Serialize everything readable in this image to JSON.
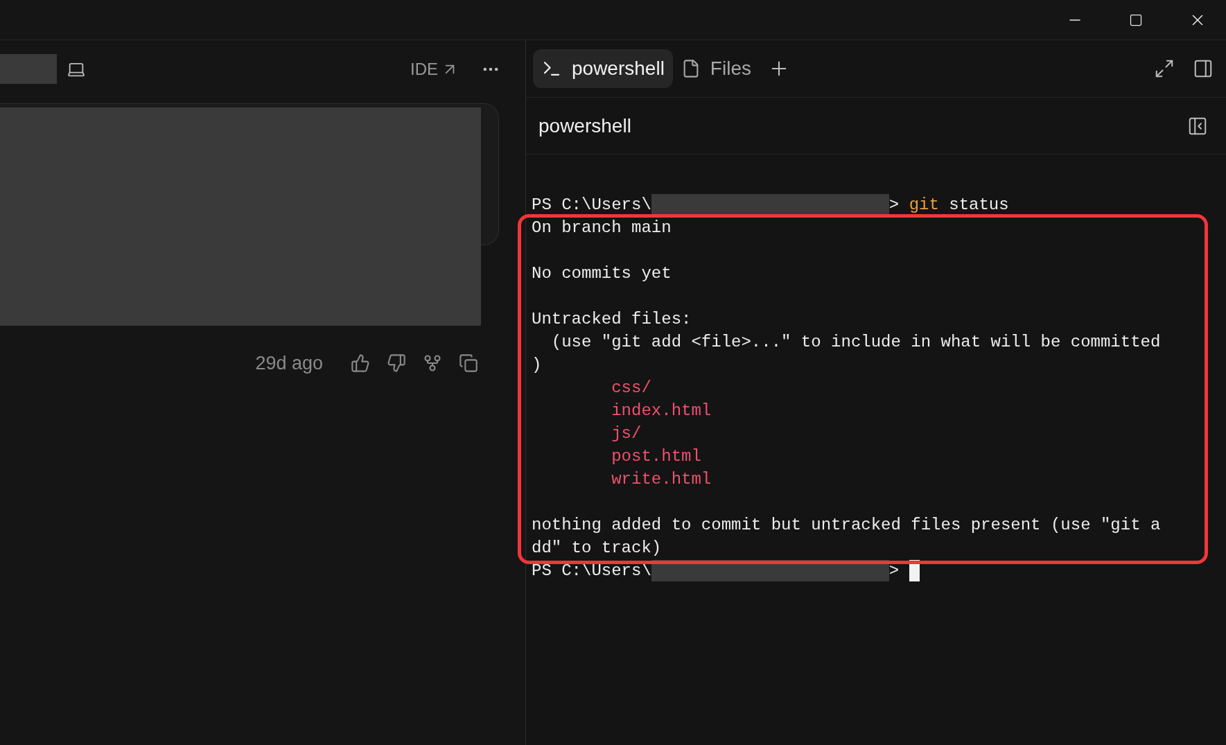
{
  "left_panel": {
    "toolbar": {
      "ide_link": "IDE"
    },
    "message": {
      "timestamp": "29d ago"
    }
  },
  "terminal": {
    "tabs": [
      {
        "label": "powershell",
        "kind": "terminal",
        "selected": true
      },
      {
        "label": "Files",
        "kind": "files",
        "selected": false
      }
    ],
    "title": "powershell",
    "lines": [
      {
        "segments": [
          {
            "kind": "text",
            "text": "PS C:\\Users\\"
          },
          {
            "kind": "redacted"
          },
          {
            "kind": "text",
            "text": "> "
          },
          {
            "kind": "command",
            "text": "git"
          },
          {
            "kind": "text",
            "text": " status"
          }
        ]
      },
      {
        "segments": [
          {
            "kind": "text",
            "text": "On branch main"
          }
        ]
      },
      {
        "kind": "blank"
      },
      {
        "segments": [
          {
            "kind": "text",
            "text": "No commits yet"
          }
        ]
      },
      {
        "kind": "blank"
      },
      {
        "segments": [
          {
            "kind": "text",
            "text": "Untracked files:"
          }
        ]
      },
      {
        "segments": [
          {
            "kind": "text",
            "text": "  (use \"git add <file>...\" to include in what will be committed"
          }
        ]
      },
      {
        "segments": [
          {
            "kind": "text",
            "text": ")"
          }
        ]
      },
      {
        "segments": [
          {
            "kind": "untracked",
            "text": "        css/"
          }
        ]
      },
      {
        "segments": [
          {
            "kind": "untracked",
            "text": "        index.html"
          }
        ]
      },
      {
        "segments": [
          {
            "kind": "untracked",
            "text": "        js/"
          }
        ]
      },
      {
        "segments": [
          {
            "kind": "untracked",
            "text": "        post.html"
          }
        ]
      },
      {
        "segments": [
          {
            "kind": "untracked",
            "text": "        write.html"
          }
        ]
      },
      {
        "kind": "blank"
      },
      {
        "segments": [
          {
            "kind": "text",
            "text": "nothing added to commit but untracked files present (use \"git a"
          }
        ]
      },
      {
        "segments": [
          {
            "kind": "text",
            "text": "dd\" to track)"
          }
        ]
      },
      {
        "segments": [
          {
            "kind": "text",
            "text": "PS C:\\Users\\"
          },
          {
            "kind": "redacted"
          },
          {
            "kind": "text",
            "text": "> "
          },
          {
            "kind": "cursor"
          }
        ]
      }
    ]
  }
}
